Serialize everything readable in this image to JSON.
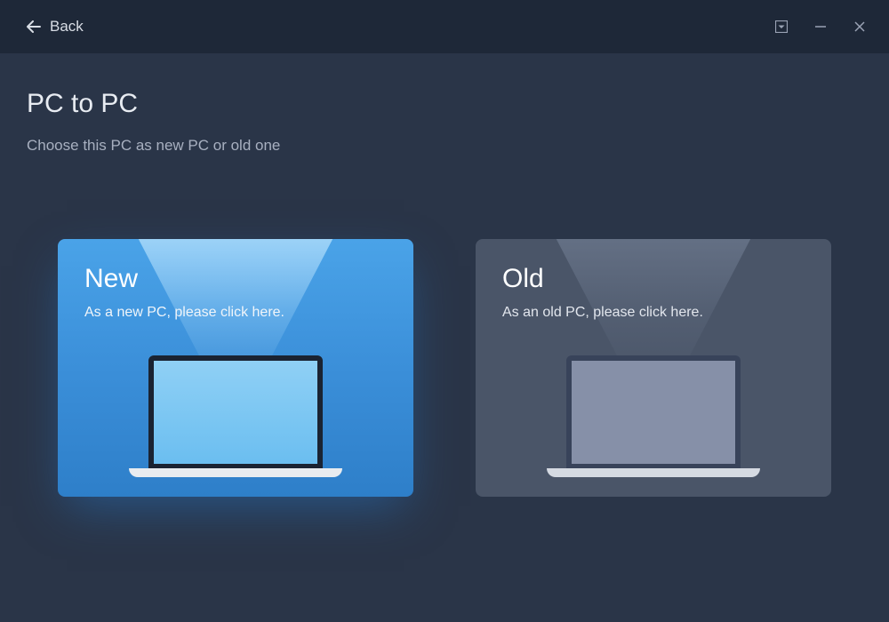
{
  "titlebar": {
    "back_label": "Back"
  },
  "header": {
    "title": "PC to PC",
    "subtitle": "Choose this PC as new PC or old one"
  },
  "cards": {
    "new": {
      "title": "New",
      "description": "As a new PC, please click here."
    },
    "old": {
      "title": "Old",
      "description": "As an old PC, please click here."
    }
  }
}
